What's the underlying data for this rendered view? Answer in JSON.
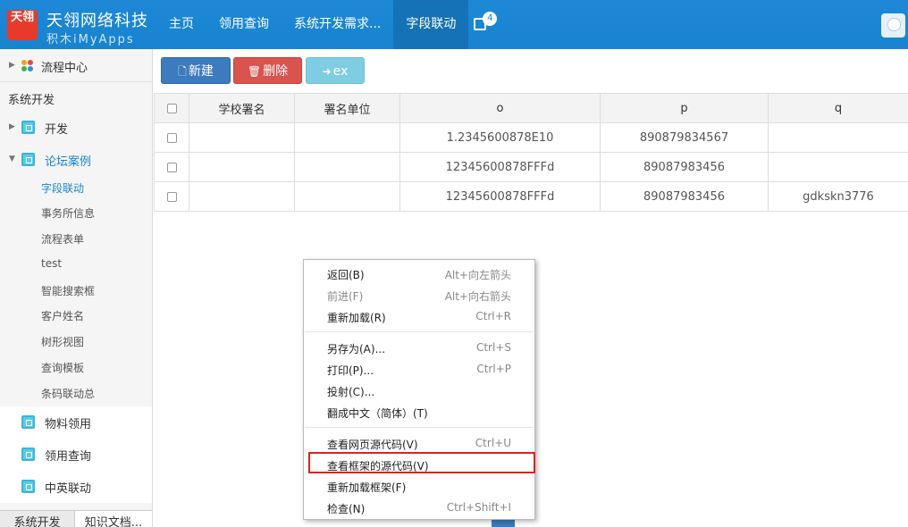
{
  "brand": {
    "title": "天翎网络科技",
    "subtitle": "积木iMyApps",
    "logo_text": "天翎",
    "color": "#1784d0"
  },
  "nav": {
    "items": [
      "主页",
      "领用查询",
      "系统开发需求...",
      "字段联动"
    ],
    "active_index": 3,
    "badge_count": "4"
  },
  "sidebar": {
    "workflow": "流程中心",
    "section": "系统开发",
    "dev": "开发",
    "forum": "论坛案例",
    "sub_items": [
      "字段联动",
      "事务所信息",
      "流程表单",
      "test",
      "智能搜索框",
      "客户姓名",
      "树形视图",
      "查询模板",
      "条码联动总"
    ],
    "active_sub": 0,
    "material": "物料领用",
    "query": "领用查询",
    "zhongying": "中英联动",
    "tabs": [
      "系统开发",
      "知识文档..."
    ]
  },
  "toolbar": {
    "new_label": "新建",
    "delete_label": "删除",
    "ex_label": "ex"
  },
  "table": {
    "columns": [
      "",
      "学校署名",
      "署名单位",
      "o",
      "p",
      "q"
    ],
    "rows": [
      [
        "",
        "",
        "",
        "1.2345600878E10",
        "890879834567",
        ""
      ],
      [
        "",
        "",
        "",
        "12345600878FFFd",
        "89087983456",
        ""
      ],
      [
        "",
        "",
        "",
        "12345600878FFFd",
        "89087983456",
        "gdkskn3776"
      ]
    ]
  },
  "context_menu": {
    "items": [
      {
        "label": "返回(B)",
        "shortcut": "Alt+向左箭头",
        "disabled": false
      },
      {
        "label": "前进(F)",
        "shortcut": "Alt+向右箭头",
        "disabled": true
      },
      {
        "label": "重新加载(R)",
        "shortcut": "Ctrl+R",
        "disabled": false
      },
      {
        "label": "另存为(A)...",
        "shortcut": "Ctrl+S",
        "disabled": false
      },
      {
        "label": "打印(P)...",
        "shortcut": "Ctrl+P",
        "disabled": false
      },
      {
        "label": "投射(C)...",
        "shortcut": "",
        "disabled": false
      },
      {
        "label": "翻成中文（简体）(T)",
        "shortcut": "",
        "disabled": false
      },
      {
        "label": "查看网页源代码(V)",
        "shortcut": "Ctrl+U",
        "disabled": false
      },
      {
        "label": "查看框架的源代码(V)",
        "shortcut": "",
        "disabled": false
      },
      {
        "label": "重新加载框架(F)",
        "shortcut": "",
        "disabled": false
      },
      {
        "label": "检查(N)",
        "shortcut": "Ctrl+Shift+I",
        "disabled": false
      }
    ],
    "highlighted_index": 8,
    "highlight_color": "#e02020"
  }
}
